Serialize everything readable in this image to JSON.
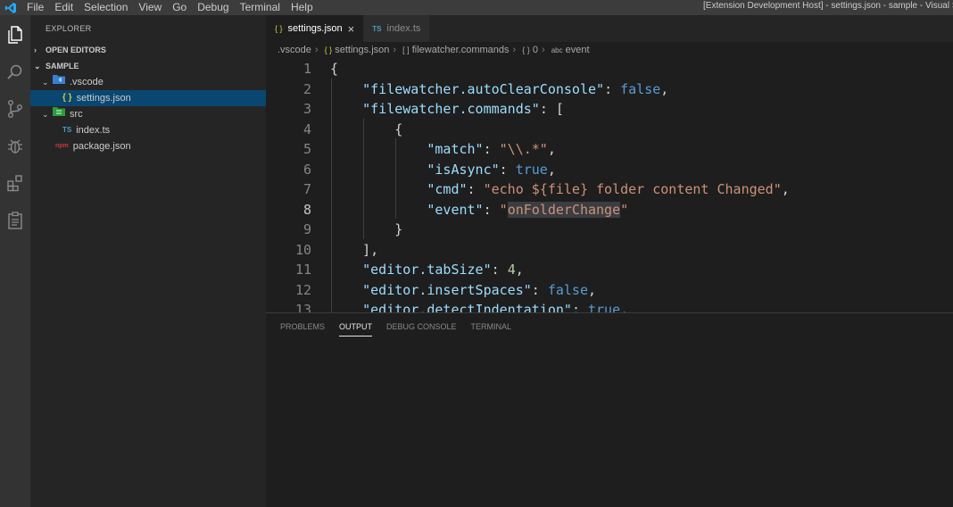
{
  "titlebar": {
    "menu": [
      "File",
      "Edit",
      "Selection",
      "View",
      "Go",
      "Debug",
      "Terminal",
      "Help"
    ],
    "window_title": "[Extension Development Host] - settings.json - sample - Visual S",
    "logo_color": "#23a9f2"
  },
  "activity_icons": [
    "files-icon",
    "search-icon",
    "source-control-icon",
    "debug-icon",
    "extensions-icon",
    "tasks-icon"
  ],
  "sidebar": {
    "header": "EXPLORER",
    "open_editors": "OPEN EDITORS",
    "workspace": "SAMPLE",
    "tree": [
      {
        "label": ".vscode",
        "icon": "{}",
        "kind": "folder"
      },
      {
        "label": "settings.json",
        "icon": "{ }",
        "kind": "json"
      },
      {
        "label": "src",
        "icon": "",
        "kind": "folder"
      },
      {
        "label": "index.ts",
        "icon": "TS",
        "kind": "ts"
      },
      {
        "label": "package.json",
        "icon": "npm",
        "kind": "npm"
      }
    ]
  },
  "tabs": [
    {
      "label": "settings.json",
      "icon": "{ }",
      "close": "×"
    },
    {
      "label": "index.ts",
      "icon": "TS"
    }
  ],
  "breadcrumb": [
    {
      "icon": "",
      "label": ".vscode"
    },
    {
      "icon": "{ }",
      "label": "settings.json"
    },
    {
      "icon": "[ ]",
      "label": "filewatcher.commands"
    },
    {
      "icon": "{ }",
      "label": "0"
    },
    {
      "icon": "abc",
      "label": "event"
    }
  ],
  "editor": {
    "current_line": 8,
    "lines": [
      {
        "n": "1",
        "tokens": [
          [
            "p",
            "{"
          ]
        ]
      },
      {
        "n": "2",
        "tokens": [
          [
            "p",
            "    "
          ],
          [
            "k",
            "\"filewatcher.autoClearConsole\""
          ],
          [
            "p",
            ": "
          ],
          [
            "b",
            "false"
          ],
          [
            "p",
            ","
          ]
        ]
      },
      {
        "n": "3",
        "tokens": [
          [
            "p",
            "    "
          ],
          [
            "k",
            "\"filewatcher.commands\""
          ],
          [
            "p",
            ": ["
          ]
        ]
      },
      {
        "n": "4",
        "tokens": [
          [
            "p",
            "        {"
          ]
        ]
      },
      {
        "n": "5",
        "tokens": [
          [
            "p",
            "            "
          ],
          [
            "k",
            "\"match\""
          ],
          [
            "p",
            ": "
          ],
          [
            "s",
            "\"\\\\.*\""
          ],
          [
            "p",
            ","
          ]
        ]
      },
      {
        "n": "6",
        "tokens": [
          [
            "p",
            "            "
          ],
          [
            "k",
            "\"isAsync\""
          ],
          [
            "p",
            ": "
          ],
          [
            "b",
            "true"
          ],
          [
            "p",
            ","
          ]
        ]
      },
      {
        "n": "7",
        "tokens": [
          [
            "p",
            "            "
          ],
          [
            "k",
            "\"cmd\""
          ],
          [
            "p",
            ": "
          ],
          [
            "s",
            "\"echo ${file} folder content Changed\""
          ],
          [
            "p",
            ","
          ]
        ]
      },
      {
        "n": "8",
        "tokens": [
          [
            "p",
            "            "
          ],
          [
            "k",
            "\"event\""
          ],
          [
            "p",
            ": "
          ],
          [
            "s",
            "\""
          ],
          [
            "sh",
            "onFolderChange"
          ],
          [
            "s",
            "\""
          ]
        ]
      },
      {
        "n": "9",
        "tokens": [
          [
            "p",
            "        }"
          ]
        ]
      },
      {
        "n": "10",
        "tokens": [
          [
            "p",
            "    ],"
          ]
        ]
      },
      {
        "n": "11",
        "tokens": [
          [
            "p",
            "    "
          ],
          [
            "k",
            "\"editor.tabSize\""
          ],
          [
            "p",
            ": "
          ],
          [
            "n",
            "4"
          ],
          [
            "p",
            ","
          ]
        ]
      },
      {
        "n": "12",
        "tokens": [
          [
            "p",
            "    "
          ],
          [
            "k",
            "\"editor.insertSpaces\""
          ],
          [
            "p",
            ": "
          ],
          [
            "b",
            "false"
          ],
          [
            "p",
            ","
          ]
        ]
      },
      {
        "n": "13",
        "tokens": [
          [
            "p",
            "    "
          ],
          [
            "k",
            "\"editor.detectIndentation\""
          ],
          [
            "p",
            ": "
          ],
          [
            "b",
            "true"
          ],
          [
            "p",
            ","
          ]
        ]
      }
    ]
  },
  "panel": {
    "tabs": [
      "PROBLEMS",
      "OUTPUT",
      "DEBUG CONSOLE",
      "TERMINAL"
    ],
    "active": "OUTPUT"
  }
}
